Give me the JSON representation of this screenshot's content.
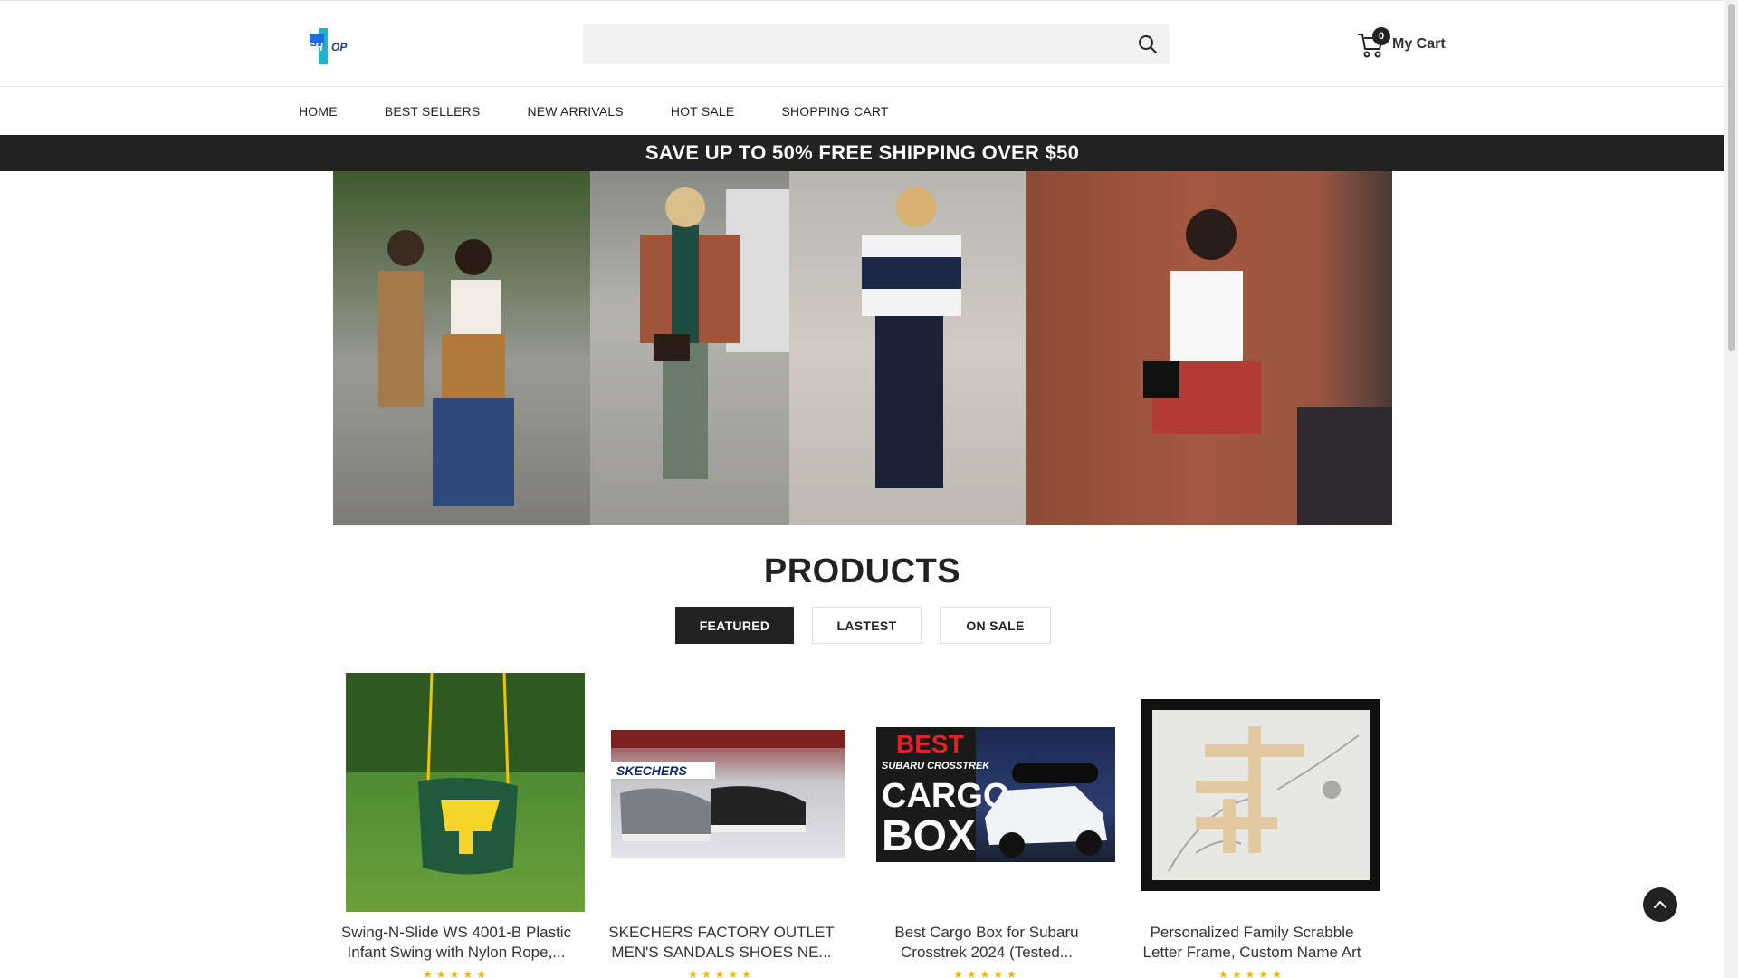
{
  "header": {
    "logo_text": "SHOP",
    "search": {
      "placeholder": "",
      "value": ""
    },
    "cart": {
      "count": "0",
      "label": "My Cart"
    }
  },
  "nav": {
    "items": [
      "HOME",
      "BEST SELLERS",
      "NEW ARRIVALS",
      "HOT SALE",
      "SHOPPING CART"
    ]
  },
  "promo": {
    "text": "SAVE UP TO 50% FREE SHIPPING OVER $50"
  },
  "products": {
    "title": "PRODUCTS",
    "tabs": [
      "FEATURED",
      "LASTEST",
      "ON SALE"
    ],
    "active_tab": "FEATURED",
    "items": [
      {
        "name_line1": "Swing-N-Slide WS 4001-B Plastic",
        "name_line2": "Infant Swing with Nylon Rope,...",
        "stars": "★★★★★"
      },
      {
        "name_line1": "SKECHERS FACTORY OUTLET",
        "name_line2": "MEN'S SANDALS SHOES NE...",
        "stars": "★★★★★",
        "image_text": "SKECHERS"
      },
      {
        "name_line1": "Best Cargo Box for Subaru",
        "name_line2": "Crosstrek 2024 (Tested...",
        "stars": "★★★★★",
        "image_text_1": "BEST",
        "image_text_2": "SUBARU CROSSTREK",
        "image_text_3": "CARGO",
        "image_text_4": "BOX"
      },
      {
        "name_line1": "Personalized Family Scrabble",
        "name_line2": "Letter Frame, Custom Name Art",
        "stars": "★★★★★"
      }
    ]
  },
  "colors": {
    "dark": "#222222",
    "star": "#f4b400",
    "logo_blue": "#1e6fd9",
    "logo_cyan": "#19b6c9"
  }
}
